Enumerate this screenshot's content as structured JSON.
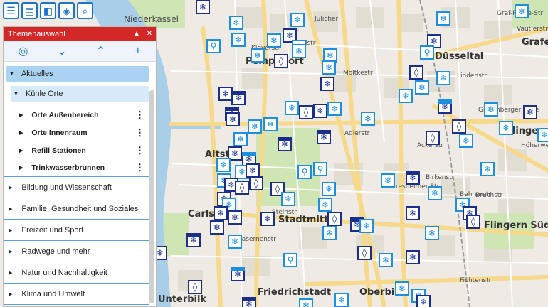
{
  "toolbar": {
    "buttons": [
      {
        "name": "menu-icon",
        "glyph": "☰"
      },
      {
        "name": "book-icon",
        "glyph": "▤"
      },
      {
        "name": "layout-icon",
        "glyph": "◧"
      },
      {
        "name": "layers-icon",
        "glyph": "◈"
      },
      {
        "name": "search-icon",
        "glyph": "⌕"
      }
    ]
  },
  "panel": {
    "title": "Themenauswahl",
    "collapse_glyph": "▲",
    "close_glyph": "✕",
    "actions": [
      {
        "name": "hide-icon",
        "glyph": "◎"
      },
      {
        "name": "expand-all-icon",
        "glyph": "⌄"
      },
      {
        "name": "collapse-all-icon",
        "glyph": "⌃"
      },
      {
        "name": "add-icon",
        "glyph": "+"
      }
    ],
    "aktuelles": "Aktuelles",
    "kuehle_orte": "Kühle Orte",
    "sub_items": [
      "Orte Außenbereich",
      "Orte Innenraum",
      "Refill Stationen",
      "Trinkwasserbrunnen"
    ],
    "categories": [
      "Bildung und Wissenschaft",
      "Familie, Gesundheit und Soziales",
      "Freizeit und Sport",
      "Radwege und mehr",
      "Natur und Nachhaltigkeit",
      "Klima und Umwelt"
    ]
  },
  "map": {
    "place_labels": [
      "Niederkassel",
      "Pempelfort",
      "Düsseltal",
      "Grafenb",
      "Flingern",
      "Altst",
      "Carls",
      "Stadtmitte",
      "Flingern Süd",
      "Friedrichstadt",
      "Oberbilk",
      "Unterbilk"
    ],
    "street_labels": [
      "Jülicher",
      "Kleverstr",
      "Nordstr",
      "Moltkestr",
      "Adlerstr",
      "Birkenstr",
      "Gerresheimer Str",
      "Behrenstr",
      "Ackerstr",
      "Steinstr",
      "Kasernenstr",
      "Graf-Recke-Str",
      "Vautierstr",
      "Grafenberger Allee",
      "Lindenstr",
      "Fichtenstr",
      "Höherweg",
      "Bruchstr"
    ],
    "colors": {
      "river": "#a9cfe8",
      "park": "#cfe6b4",
      "road_major": "#f7d98b",
      "water_marker": "#1d8fe0",
      "dark_marker": "#1b2f8a"
    }
  }
}
